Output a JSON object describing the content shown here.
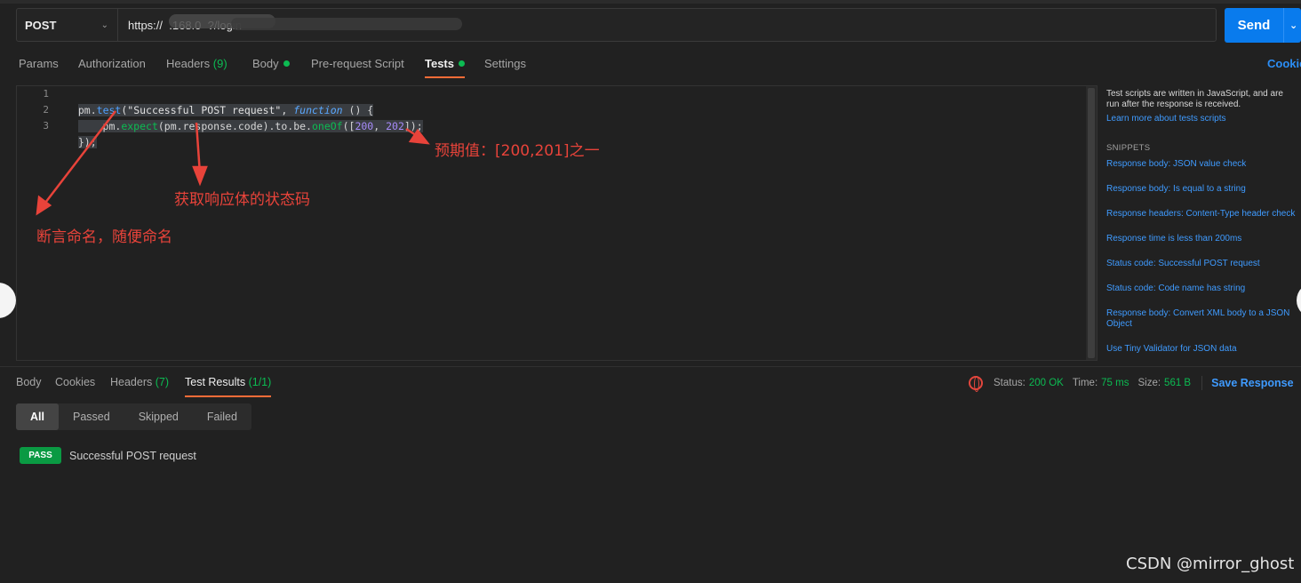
{
  "request": {
    "method": "POST",
    "url": "https://  .168.0  ?/login",
    "send_label": "Send"
  },
  "request_tabs": {
    "params": "Params",
    "authorization": "Authorization",
    "headers": "Headers",
    "headers_count": "(9)",
    "body": "Body",
    "prerequest": "Pre-request Script",
    "tests": "Tests",
    "settings": "Settings",
    "cookies": "Cookies"
  },
  "editor": {
    "line_numbers": [
      "1",
      "2",
      "3"
    ],
    "line1": {
      "a": "pm.",
      "b": "test",
      "c": "(\"Successful POST request\", ",
      "d": "function",
      "e": " () {"
    },
    "line2": {
      "a": "    pm.",
      "b": "expect",
      "c": "(pm.response.code).to.be.",
      "d": "oneOf",
      "e": "([",
      "f": "200",
      "g": ", ",
      "h": "202",
      "i": "]);"
    },
    "line3": "});"
  },
  "annotations": {
    "name_note": "断言命名，随便命名",
    "status_note": "获取响应体的状态码",
    "expected_note": "预期值：[200,201]之一"
  },
  "snippets_panel": {
    "description": "Test scripts are written in JavaScript, and are run after the response is received.",
    "learn_more": "Learn more about tests scripts",
    "heading": "SNIPPETS",
    "items": [
      "Response body: JSON value check",
      "Response body: Is equal to a string",
      "Response headers: Content-Type header check",
      "Response time is less than 200ms",
      "Status code: Successful POST request",
      "Status code: Code name has string",
      "Response body: Convert XML body to a JSON Object",
      "Use Tiny Validator for JSON data"
    ]
  },
  "response_tabs": {
    "body": "Body",
    "cookies": "Cookies",
    "headers": "Headers",
    "headers_count": "(7)",
    "test_results": "Test Results",
    "test_results_count": "(1/1)"
  },
  "response_status": {
    "status_label": "Status:",
    "status_value": "200 OK",
    "time_label": "Time:",
    "time_value": "75 ms",
    "size_label": "Size:",
    "size_value": "561 B",
    "save_response": "Save Response"
  },
  "filters": [
    "All",
    "Passed",
    "Skipped",
    "Failed"
  ],
  "results": [
    {
      "badge": "PASS",
      "name": "Successful POST request"
    }
  ],
  "watermark": "CSDN @mirror_ghost",
  "colors": {
    "accent": "#ff6c37",
    "send_blue": "#097bed",
    "pass_green": "#0a9a43",
    "annotation_red": "#e8433a"
  }
}
